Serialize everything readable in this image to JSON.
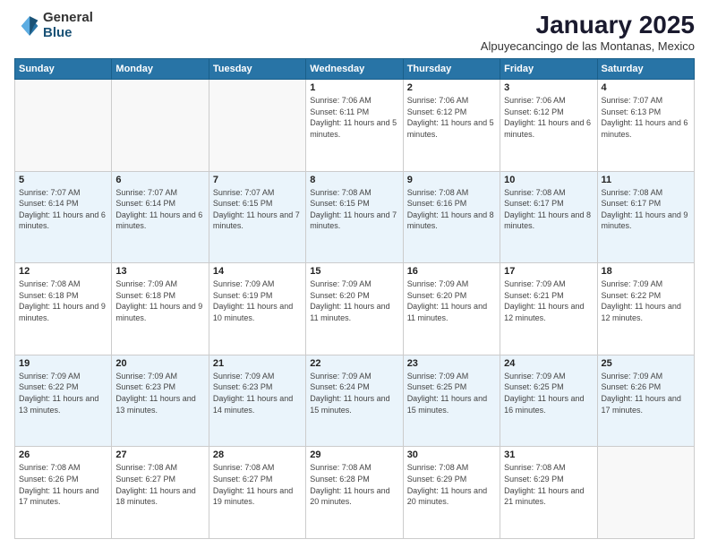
{
  "header": {
    "logo_general": "General",
    "logo_blue": "Blue",
    "month": "January 2025",
    "location": "Alpuyecancingo de las Montanas, Mexico"
  },
  "days_of_week": [
    "Sunday",
    "Monday",
    "Tuesday",
    "Wednesday",
    "Thursday",
    "Friday",
    "Saturday"
  ],
  "weeks": [
    [
      {
        "day": "",
        "info": ""
      },
      {
        "day": "",
        "info": ""
      },
      {
        "day": "",
        "info": ""
      },
      {
        "day": "1",
        "info": "Sunrise: 7:06 AM\nSunset: 6:11 PM\nDaylight: 11 hours and 5 minutes."
      },
      {
        "day": "2",
        "info": "Sunrise: 7:06 AM\nSunset: 6:12 PM\nDaylight: 11 hours and 5 minutes."
      },
      {
        "day": "3",
        "info": "Sunrise: 7:06 AM\nSunset: 6:12 PM\nDaylight: 11 hours and 6 minutes."
      },
      {
        "day": "4",
        "info": "Sunrise: 7:07 AM\nSunset: 6:13 PM\nDaylight: 11 hours and 6 minutes."
      }
    ],
    [
      {
        "day": "5",
        "info": "Sunrise: 7:07 AM\nSunset: 6:14 PM\nDaylight: 11 hours and 6 minutes."
      },
      {
        "day": "6",
        "info": "Sunrise: 7:07 AM\nSunset: 6:14 PM\nDaylight: 11 hours and 6 minutes."
      },
      {
        "day": "7",
        "info": "Sunrise: 7:07 AM\nSunset: 6:15 PM\nDaylight: 11 hours and 7 minutes."
      },
      {
        "day": "8",
        "info": "Sunrise: 7:08 AM\nSunset: 6:15 PM\nDaylight: 11 hours and 7 minutes."
      },
      {
        "day": "9",
        "info": "Sunrise: 7:08 AM\nSunset: 6:16 PM\nDaylight: 11 hours and 8 minutes."
      },
      {
        "day": "10",
        "info": "Sunrise: 7:08 AM\nSunset: 6:17 PM\nDaylight: 11 hours and 8 minutes."
      },
      {
        "day": "11",
        "info": "Sunrise: 7:08 AM\nSunset: 6:17 PM\nDaylight: 11 hours and 9 minutes."
      }
    ],
    [
      {
        "day": "12",
        "info": "Sunrise: 7:08 AM\nSunset: 6:18 PM\nDaylight: 11 hours and 9 minutes."
      },
      {
        "day": "13",
        "info": "Sunrise: 7:09 AM\nSunset: 6:18 PM\nDaylight: 11 hours and 9 minutes."
      },
      {
        "day": "14",
        "info": "Sunrise: 7:09 AM\nSunset: 6:19 PM\nDaylight: 11 hours and 10 minutes."
      },
      {
        "day": "15",
        "info": "Sunrise: 7:09 AM\nSunset: 6:20 PM\nDaylight: 11 hours and 11 minutes."
      },
      {
        "day": "16",
        "info": "Sunrise: 7:09 AM\nSunset: 6:20 PM\nDaylight: 11 hours and 11 minutes."
      },
      {
        "day": "17",
        "info": "Sunrise: 7:09 AM\nSunset: 6:21 PM\nDaylight: 11 hours and 12 minutes."
      },
      {
        "day": "18",
        "info": "Sunrise: 7:09 AM\nSunset: 6:22 PM\nDaylight: 11 hours and 12 minutes."
      }
    ],
    [
      {
        "day": "19",
        "info": "Sunrise: 7:09 AM\nSunset: 6:22 PM\nDaylight: 11 hours and 13 minutes."
      },
      {
        "day": "20",
        "info": "Sunrise: 7:09 AM\nSunset: 6:23 PM\nDaylight: 11 hours and 13 minutes."
      },
      {
        "day": "21",
        "info": "Sunrise: 7:09 AM\nSunset: 6:23 PM\nDaylight: 11 hours and 14 minutes."
      },
      {
        "day": "22",
        "info": "Sunrise: 7:09 AM\nSunset: 6:24 PM\nDaylight: 11 hours and 15 minutes."
      },
      {
        "day": "23",
        "info": "Sunrise: 7:09 AM\nSunset: 6:25 PM\nDaylight: 11 hours and 15 minutes."
      },
      {
        "day": "24",
        "info": "Sunrise: 7:09 AM\nSunset: 6:25 PM\nDaylight: 11 hours and 16 minutes."
      },
      {
        "day": "25",
        "info": "Sunrise: 7:09 AM\nSunset: 6:26 PM\nDaylight: 11 hours and 17 minutes."
      }
    ],
    [
      {
        "day": "26",
        "info": "Sunrise: 7:08 AM\nSunset: 6:26 PM\nDaylight: 11 hours and 17 minutes."
      },
      {
        "day": "27",
        "info": "Sunrise: 7:08 AM\nSunset: 6:27 PM\nDaylight: 11 hours and 18 minutes."
      },
      {
        "day": "28",
        "info": "Sunrise: 7:08 AM\nSunset: 6:27 PM\nDaylight: 11 hours and 19 minutes."
      },
      {
        "day": "29",
        "info": "Sunrise: 7:08 AM\nSunset: 6:28 PM\nDaylight: 11 hours and 20 minutes."
      },
      {
        "day": "30",
        "info": "Sunrise: 7:08 AM\nSunset: 6:29 PM\nDaylight: 11 hours and 20 minutes."
      },
      {
        "day": "31",
        "info": "Sunrise: 7:08 AM\nSunset: 6:29 PM\nDaylight: 11 hours and 21 minutes."
      },
      {
        "day": "",
        "info": ""
      }
    ]
  ]
}
